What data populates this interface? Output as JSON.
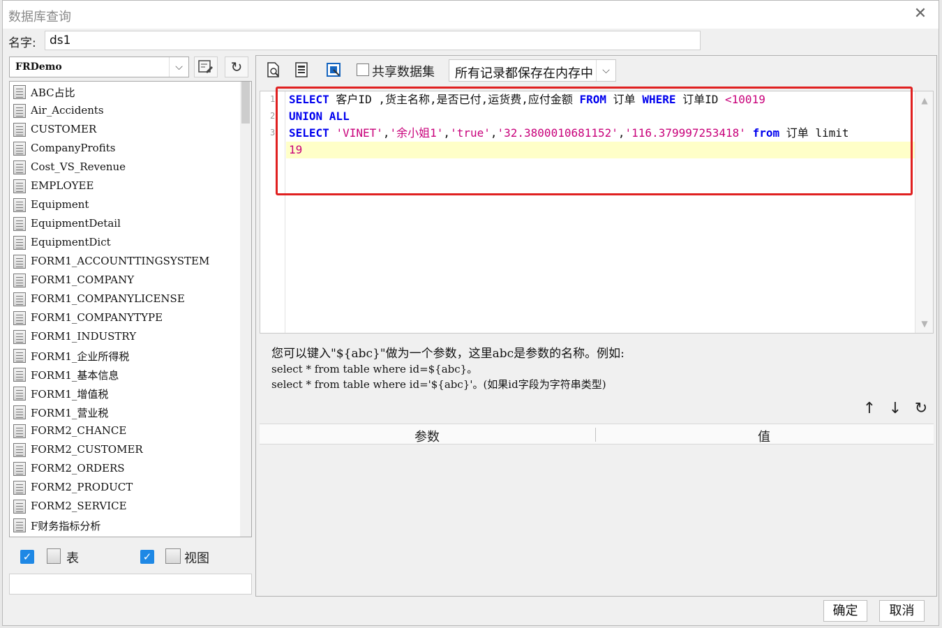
{
  "window": {
    "title": "数据库查询",
    "close_glyph": "✕"
  },
  "name_field": {
    "label": "名字:",
    "value": "ds1"
  },
  "datasource": {
    "selected": "FRDemo"
  },
  "table_list": {
    "items": [
      "ABC占比",
      "Air_Accidents",
      "CUSTOMER",
      "CompanyProfits",
      "Cost_VS_Revenue",
      "EMPLOYEE",
      "Equipment",
      "EquipmentDetail",
      "EquipmentDict",
      "FORM1_ACCOUNTTINGSYSTEM",
      "FORM1_COMPANY",
      "FORM1_COMPANYLICENSE",
      "FORM1_COMPANYTYPE",
      "FORM1_INDUSTRY",
      "FORM1_企业所得税",
      "FORM1_基本信息",
      "FORM1_增值税",
      "FORM1_营业税",
      "FORM2_CHANCE",
      "FORM2_CUSTOMER",
      "FORM2_ORDERS",
      "FORM2_PRODUCT",
      "FORM2_SERVICE",
      "F财务指标分析"
    ]
  },
  "filters": {
    "table_label": "表",
    "view_label": "视图",
    "table_checked": true,
    "view_checked": true
  },
  "toolbar": {
    "shared_label": "共享数据集",
    "mode_value": "所有记录都保存在内存中"
  },
  "editor": {
    "line_numbers": [
      "1",
      "2",
      "3"
    ],
    "line1": {
      "k1": "SELECT",
      "t1": " 客户ID ,货主名称,是否已付,运货费,应付金额 ",
      "k2": "FROM",
      "t2": " 订单 ",
      "k3": "WHERE",
      "t3": " 订单ID ",
      "n1": "<10019"
    },
    "line2": {
      "k1": "UNION ALL"
    },
    "line3": {
      "k1": "SELECT",
      "t1": " ",
      "s1": "'VINET'",
      "c1": ",",
      "s2": "'余小姐1'",
      "c2": ",",
      "s3": "'true'",
      "c3": ",",
      "s4": "'32.3800010681152'",
      "c4": ",",
      "s5": "'116.379997253418'",
      "t2": " ",
      "k2": "from",
      "t3": " 订单 limit"
    },
    "line4": {
      "n1": "19"
    }
  },
  "hint": {
    "line1": "您可以键入\"${abc}\"做为一个参数，这里abc是参数的名称。例如:",
    "line2": "select * from table where id=${abc}。",
    "line3": "select * from table where id='${abc}'。(如果id字段为字符串类型)"
  },
  "param_table": {
    "col_param": "参数",
    "col_value": "值"
  },
  "buttons": {
    "ok": "确定",
    "cancel": "取消"
  },
  "colors": {
    "keyword": "#0000ee",
    "string": "#c8007a",
    "highlight_box": "#e02020",
    "checkbox": "#1e88e5"
  }
}
